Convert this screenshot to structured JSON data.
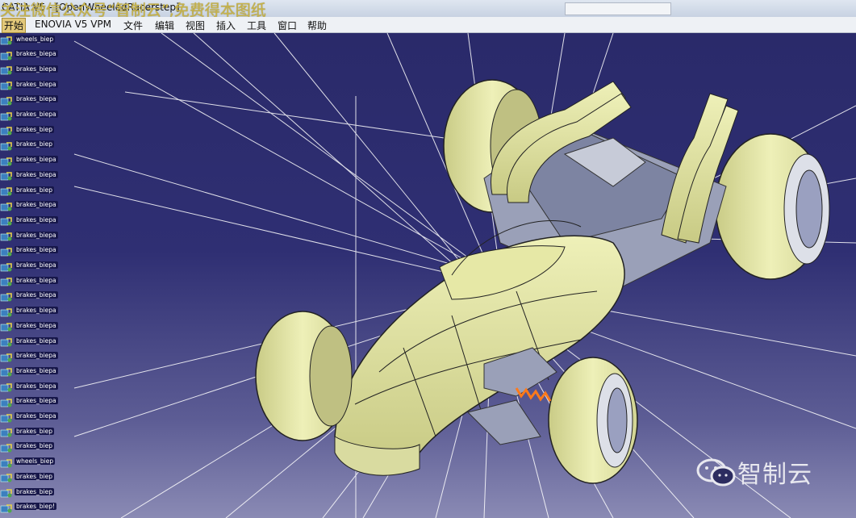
{
  "window": {
    "title": "CATIA V5 - [OpenWheeledRacerstep]",
    "watermark_top": "关注微信公众号“智制云”,免费得本图纸"
  },
  "menu": [
    "开始",
    "ENOVIA V5 VPM",
    "文件",
    "编辑",
    "视图",
    "插入",
    "工具",
    "窗口",
    "帮助"
  ],
  "tree": [
    "wheels_biep",
    "brakes_biepa",
    "brakes_biepa",
    "brakes_biepa",
    "brakes_biepa",
    "brakes_biepa",
    "brakes_biep",
    "brakes_biep",
    "brakes_biepa",
    "brakes_biepa",
    "brakes_biep",
    "brakes_biepa",
    "brakes_biepa",
    "brakes_biepa",
    "brakes_biepa",
    "brakes_biepa",
    "brakes_biepa",
    "brakes_biepa",
    "brakes_biepa",
    "brakes_biepa",
    "brakes_biepa",
    "brakes_biepa",
    "brakes_biepa",
    "brakes_biepa",
    "brakes_biepa",
    "brakes_biepa",
    "brakes_biep",
    "brakes_biep",
    "wheels_biep",
    "brakes_biep",
    "brakes_biep",
    "brakes_biep!"
  ],
  "watermark_bottom": "智制云",
  "colors": {
    "body": "#e6e8a6",
    "background_top": "#2a2a6a",
    "background_bottom": "#8a8ab4",
    "spring": "#ff7a1a"
  }
}
